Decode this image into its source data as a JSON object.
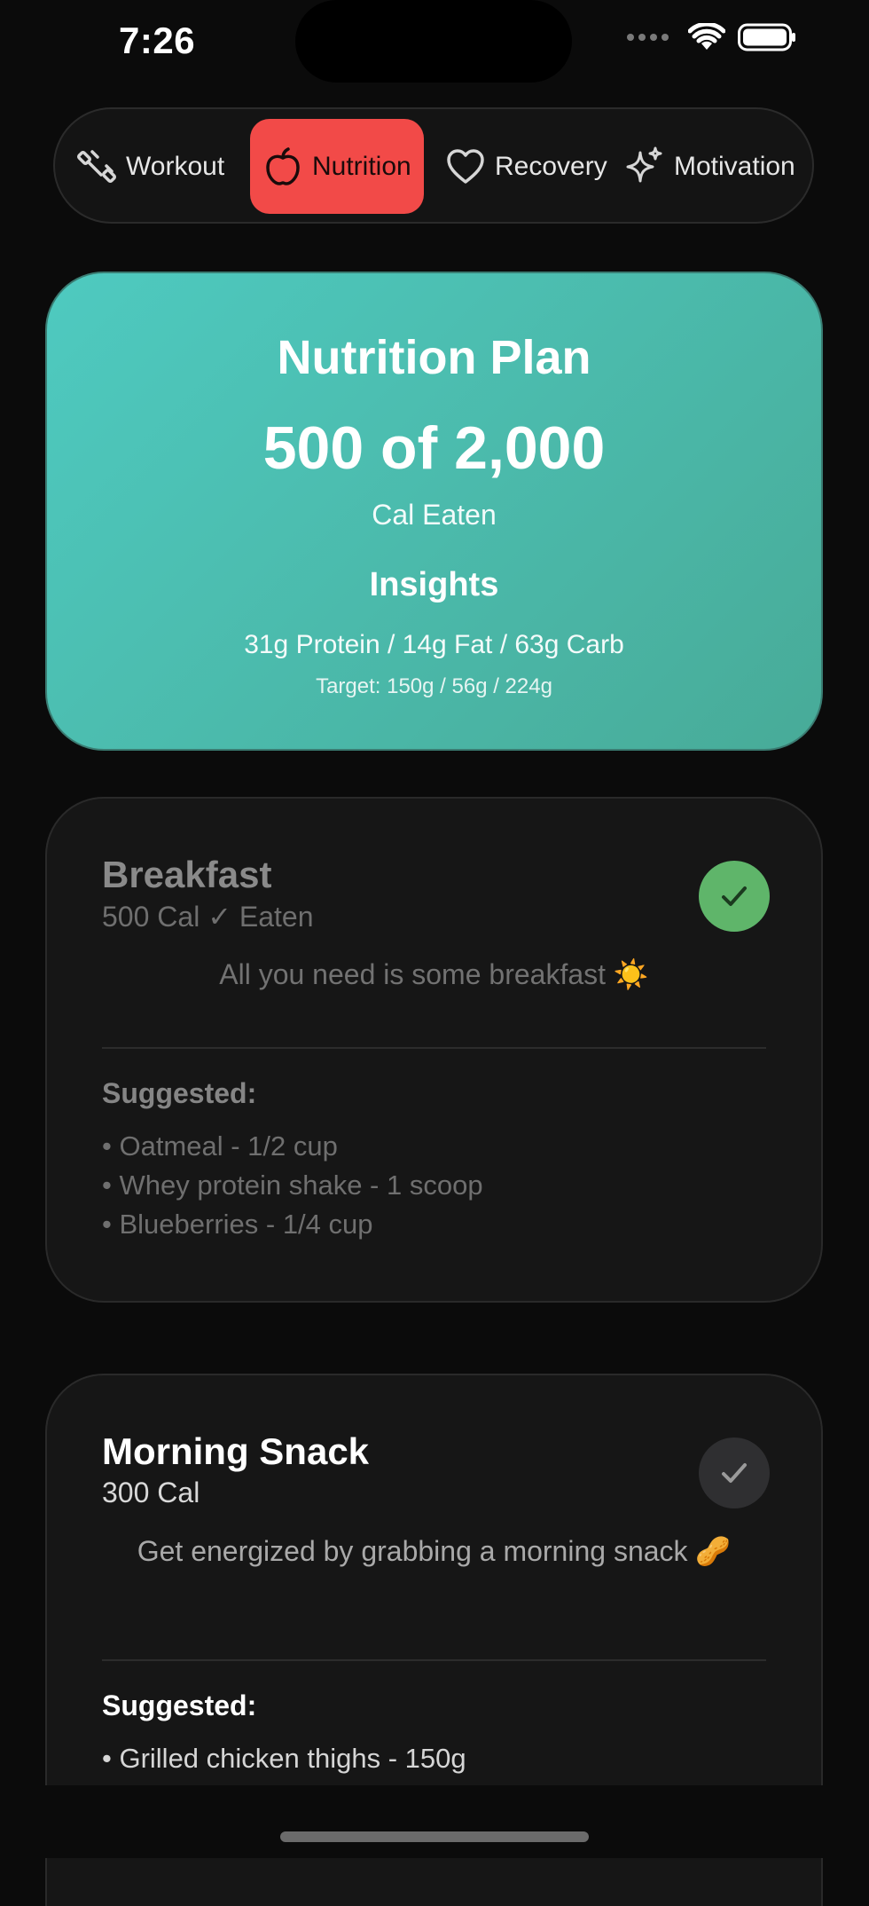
{
  "status_bar": {
    "time": "7:26"
  },
  "tabs": [
    {
      "label": "Workout",
      "icon": "dumbbell-icon",
      "active": false
    },
    {
      "label": "Nutrition",
      "icon": "apple-icon",
      "active": true
    },
    {
      "label": "Recovery",
      "icon": "heart-icon",
      "active": false
    },
    {
      "label": "Motivation",
      "icon": "sparkles-icon",
      "active": false
    }
  ],
  "hero": {
    "title": "Nutrition Plan",
    "calories": "500 of 2,000",
    "calories_label": "Cal Eaten",
    "insights_title": "Insights",
    "macros": "31g Protein / 14g Fat / 63g Carb",
    "target": "Target: 150g / 56g / 224g"
  },
  "meals": [
    {
      "name": "Breakfast",
      "calories": "500 Cal ✓ Eaten",
      "description": "All you need is some breakfast ☀️",
      "suggested_label": "Suggested:",
      "items": [
        "Oatmeal - 1/2 cup",
        "Whey protein shake - 1 scoop",
        "Blueberries - 1/4 cup"
      ],
      "eaten": true
    },
    {
      "name": "Morning Snack",
      "calories": "300 Cal",
      "description": "Get energized by grabbing a morning snack 🥜",
      "suggested_label": "Suggested:",
      "items": [
        "Grilled chicken thighs - 150g"
      ],
      "eaten": false
    }
  ],
  "colors": {
    "accent_tab": "#f24a48",
    "hero_gradient_start": "#4ecac0",
    "hero_gradient_end": "#48ab98",
    "eaten_check": "#5fb56a",
    "background": "#0b0b0b"
  }
}
